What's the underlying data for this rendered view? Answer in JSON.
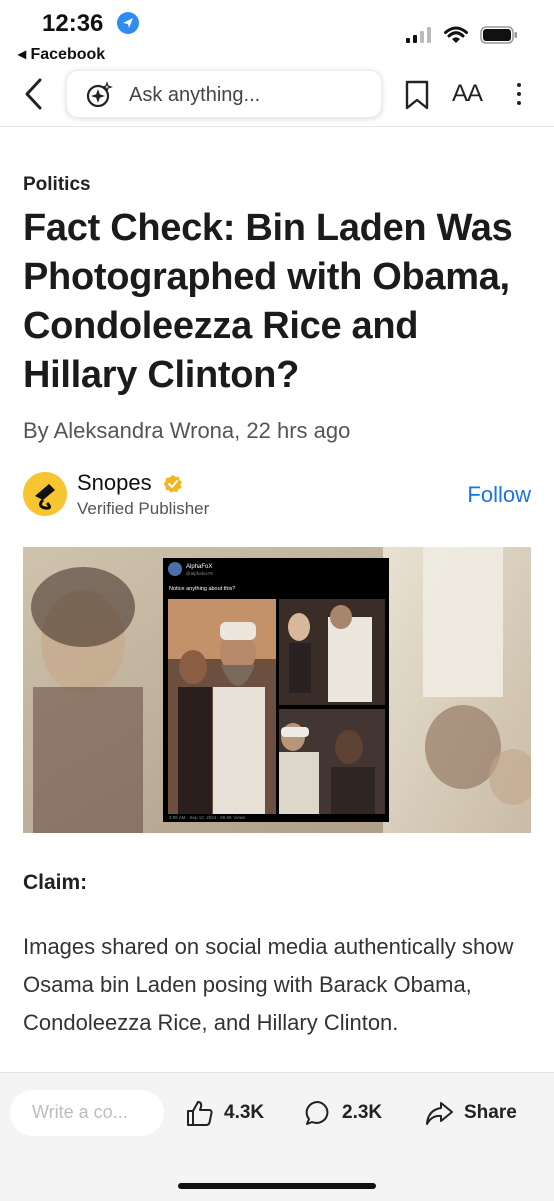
{
  "status": {
    "time": "12:36",
    "back_app": "◂ Facebook"
  },
  "nav": {
    "search_placeholder": "Ask anything...",
    "text_size_label": "AA"
  },
  "article": {
    "category": "Politics",
    "headline": "Fact Check: Bin Laden Was Photographed with Obama, Condoleezza Rice and Hillary Clinton?",
    "byline": "By Aleksandra Wrona, 22 hrs ago",
    "publisher": {
      "name": "Snopes",
      "subtitle": "Verified Publisher",
      "follow_label": "Follow"
    },
    "hero_tweet": {
      "account": "AlphaFoX",
      "handle": "@alphafox79",
      "text": "Notice anything about this?",
      "footer": "3:06 AM · Sep 12, 2024 · 65.6K Views"
    },
    "claim_label": "Claim:",
    "claim_text": "Images shared on social media authentically show Osama bin Laden posing with Barack Obama, Condoleezza Rice, and Hillary Clinton."
  },
  "bottom": {
    "comment_placeholder": "Write a co...",
    "likes": "4.3K",
    "comments": "2.3K",
    "share_label": "Share"
  },
  "colors": {
    "accent": "#1a73e8",
    "location": "#2f8cf0",
    "snopes_yellow": "#f7c531"
  }
}
